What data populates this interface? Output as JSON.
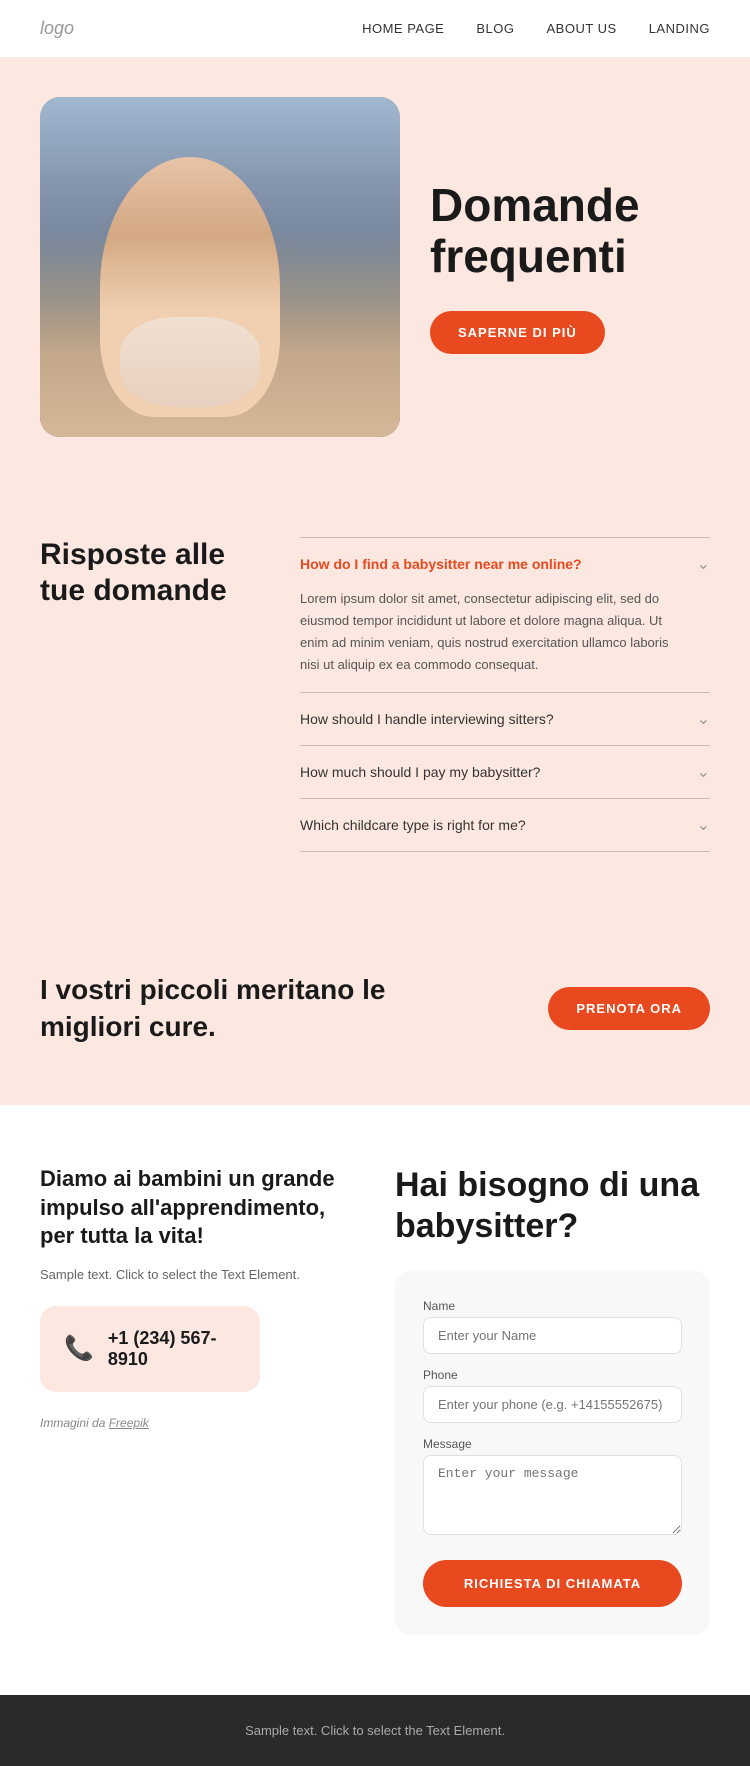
{
  "nav": {
    "logo": "logo",
    "links": [
      {
        "label": "HOME PAGE",
        "id": "home"
      },
      {
        "label": "BLOG",
        "id": "blog"
      },
      {
        "label": "ABOUT US",
        "id": "about"
      },
      {
        "label": "LANDING",
        "id": "landing"
      }
    ]
  },
  "hero": {
    "title": "Domande frequenti",
    "cta_button": "SAPERNE DI PIÙ"
  },
  "faq": {
    "section_title": "Risposte alle tue domande",
    "items": [
      {
        "id": "q1",
        "question": "How do I find a babysitter near me online?",
        "open": true,
        "answer": "Lorem ipsum dolor sit amet, consectetur adipiscing elit, sed do eiusmod tempor incididunt ut labore et dolore magna aliqua. Ut enim ad minim veniam, quis nostrud exercitation ullamco laboris nisi ut aliquip ex ea commodo consequat."
      },
      {
        "id": "q2",
        "question": "How should I handle interviewing sitters?",
        "open": false,
        "answer": ""
      },
      {
        "id": "q3",
        "question": "How much should I pay my babysitter?",
        "open": false,
        "answer": ""
      },
      {
        "id": "q4",
        "question": "Which childcare type is right for me?",
        "open": false,
        "answer": ""
      }
    ]
  },
  "cta": {
    "title": "I vostri piccoli meritano le migliori cure.",
    "button": "PRENOTA ORA"
  },
  "contact": {
    "left_title": "Diamo ai bambini un grande impulso all'apprendimento, per tutta la vita!",
    "sample_text": "Sample text. Click to select the Text Element.",
    "phone": "+1 (234) 567-8910",
    "freepik_label": "Immagini da",
    "freepik_link": "Freepik",
    "right_title": "Hai bisogno di una babysitter?",
    "form": {
      "name_label": "Name",
      "name_placeholder": "Enter your Name",
      "phone_label": "Phone",
      "phone_placeholder": "Enter your phone (e.g. +14155552675)",
      "message_label": "Message",
      "message_placeholder": "Enter your message",
      "submit_button": "RICHIESTA DI CHIAMATA"
    }
  },
  "footer": {
    "text": "Sample text. Click to select the Text Element."
  }
}
